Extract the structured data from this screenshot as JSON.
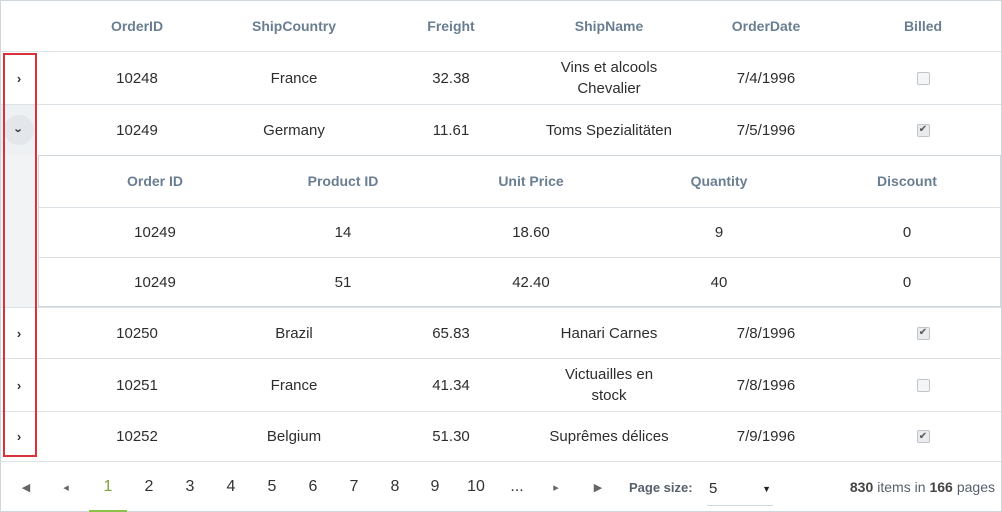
{
  "columns": {
    "order_id": "OrderID",
    "ship_country": "ShipCountry",
    "freight": "Freight",
    "ship_name": "ShipName",
    "order_date": "OrderDate",
    "billed": "Billed"
  },
  "rows": [
    {
      "order_id": "10248",
      "ship_country": "France",
      "freight": "32.38",
      "ship_name": "Vins et alcools Chevalier",
      "order_date": "7/4/1996",
      "billed": false,
      "expanded": false
    },
    {
      "order_id": "10249",
      "ship_country": "Germany",
      "freight": "11.61",
      "ship_name": "Toms Spezialitäten",
      "order_date": "7/5/1996",
      "billed": true,
      "expanded": true
    },
    {
      "order_id": "10250",
      "ship_country": "Brazil",
      "freight": "65.83",
      "ship_name": "Hanari Carnes",
      "order_date": "7/8/1996",
      "billed": true,
      "expanded": false
    },
    {
      "order_id": "10251",
      "ship_country": "France",
      "freight": "41.34",
      "ship_name": "Victuailles en stock",
      "order_date": "7/8/1996",
      "billed": false,
      "expanded": false
    },
    {
      "order_id": "10252",
      "ship_country": "Belgium",
      "freight": "51.30",
      "ship_name": "Suprêmes délices",
      "order_date": "7/9/1996",
      "billed": true,
      "expanded": false
    }
  ],
  "detail": {
    "columns": {
      "order_id": "Order ID",
      "product_id": "Product ID",
      "unit_price": "Unit Price",
      "quantity": "Quantity",
      "discount": "Discount"
    },
    "rows": [
      {
        "order_id": "10249",
        "product_id": "14",
        "unit_price": "18.60",
        "quantity": "9",
        "discount": "0"
      },
      {
        "order_id": "10249",
        "product_id": "51",
        "unit_price": "42.40",
        "quantity": "40",
        "discount": "0"
      }
    ]
  },
  "icons": {
    "collapsed": "chevron-right-icon",
    "expanded": "chevron-down-icon",
    "first": "first-page-icon",
    "prev": "prev-page-icon",
    "next": "next-page-icon",
    "last": "last-page-icon",
    "dropdown": "caret-down-icon"
  },
  "pager": {
    "pages": [
      "1",
      "2",
      "3",
      "4",
      "5",
      "6",
      "7",
      "8",
      "9",
      "10",
      "..."
    ],
    "current_page": "1",
    "page_size_label": "Page size:",
    "page_size": "5",
    "total_items": "830",
    "items_in_label": "items in",
    "total_pages": "166",
    "pages_label": "pages"
  },
  "colors": {
    "accent": "#8bc34a",
    "highlight": "#d9323b",
    "header_text": "#6a7e91"
  }
}
